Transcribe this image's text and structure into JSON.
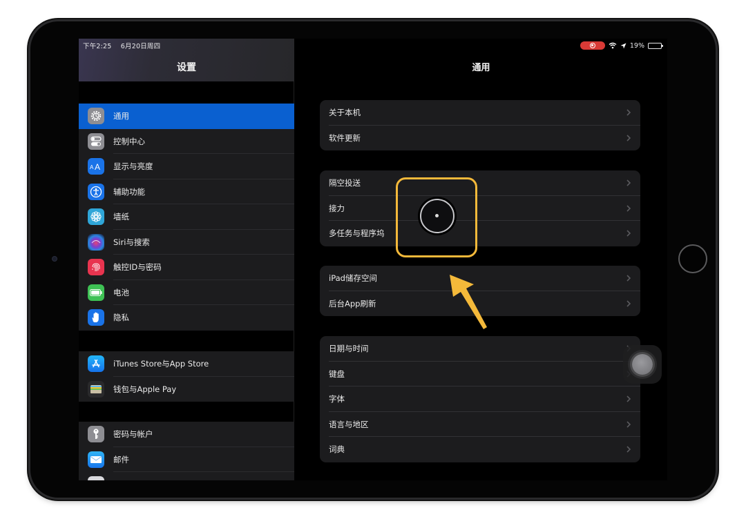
{
  "status_bar": {
    "time": "下午2:25",
    "date": "6月20日周四",
    "battery": "19%",
    "battery_level": 0.19,
    "icons": [
      "screen-recording-icon",
      "wifi-icon",
      "location-icon",
      "battery-icon"
    ]
  },
  "sidebar": {
    "title": "设置",
    "groups": [
      {
        "items": [
          {
            "label": "通用",
            "icon": "gear-icon",
            "color": "#8e8e93",
            "selected": true
          },
          {
            "label": "控制中心",
            "icon": "toggles-icon",
            "color": "#8e8e93"
          },
          {
            "label": "显示与亮度",
            "icon": "text-size-icon",
            "color": "#1a73e8"
          },
          {
            "label": "辅助功能",
            "icon": "accessibility-icon",
            "color": "#1a73e8"
          },
          {
            "label": "墙纸",
            "icon": "flower-icon",
            "color": "#2fa6d8"
          },
          {
            "label": "Siri与搜索",
            "icon": "siri-icon",
            "color": "#2a2440"
          },
          {
            "label": "触控ID与密码",
            "icon": "fingerprint-icon",
            "color": "#e8344f"
          },
          {
            "label": "电池",
            "icon": "battery-icon",
            "color": "#3ec154"
          },
          {
            "label": "隐私",
            "icon": "hand-icon",
            "color": "#1a73e8"
          }
        ]
      },
      {
        "items": [
          {
            "label": "iTunes Store与App Store",
            "icon": "app-store-icon",
            "color": "#1c8ef2"
          },
          {
            "label": "钱包与Apple Pay",
            "icon": "wallet-icon",
            "color": "#2a2a2c"
          }
        ]
      },
      {
        "items": [
          {
            "label": "密码与帐户",
            "icon": "key-icon",
            "color": "#8e8e93"
          },
          {
            "label": "邮件",
            "icon": "mail-icon",
            "color": "#1d8cf0"
          }
        ]
      }
    ]
  },
  "detail": {
    "title": "通用",
    "groups": [
      {
        "rows": [
          "关于本机",
          "软件更新"
        ]
      },
      {
        "rows": [
          "隔空投送",
          "接力",
          "多任务与程序坞"
        ]
      },
      {
        "rows": [
          "iPad储存空间",
          "后台App刷新"
        ]
      },
      {
        "rows": [
          "日期与时间",
          "键盘",
          "字体",
          "语言与地区",
          "词典"
        ]
      }
    ]
  },
  "colors": {
    "accent": "#0a60d0",
    "highlight": "#f4b93a",
    "cell_background": "#1c1c1e",
    "record": "#d93a36"
  }
}
